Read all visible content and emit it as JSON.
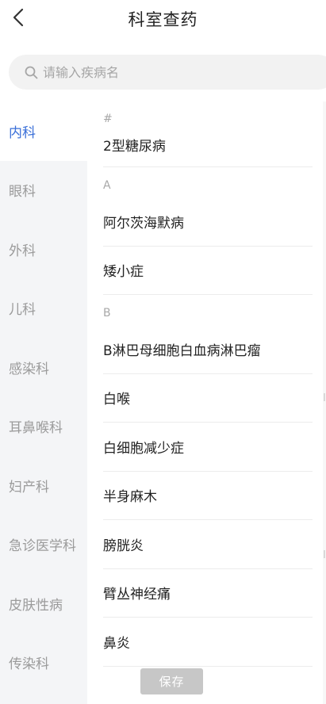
{
  "header": {
    "title": "科室查药"
  },
  "search": {
    "placeholder": "请输入疾病名",
    "value": ""
  },
  "sidebar": {
    "active_index": 0,
    "items": [
      {
        "label": "内科"
      },
      {
        "label": "眼科"
      },
      {
        "label": "外科"
      },
      {
        "label": "儿科"
      },
      {
        "label": "感染科"
      },
      {
        "label": "耳鼻喉科"
      },
      {
        "label": "妇产科"
      },
      {
        "label": "急诊医学科"
      },
      {
        "label": "皮肤性病"
      },
      {
        "label": "传染科"
      }
    ]
  },
  "list": {
    "sections": [
      {
        "letter": "#",
        "items": [
          "2型糖尿病"
        ]
      },
      {
        "letter": "A",
        "items": [
          "阿尔茨海默病",
          "矮小症"
        ]
      },
      {
        "letter": "B",
        "items": [
          "B淋巴母细胞白血病淋巴瘤",
          "白喉",
          "白细胞减少症",
          "半身麻木",
          "膀胱炎",
          "臂丛神经痛",
          "鼻炎"
        ]
      }
    ]
  },
  "footer": {
    "save_label": "保存"
  },
  "colors": {
    "accent": "#3a6fd8",
    "sidebar_bg": "#f4f5f7",
    "muted_text": "#9b9b9b",
    "search_bg": "#f2f2f2",
    "save_button_bg": "#c7c7c7"
  },
  "icons": {
    "back": "chevron-left-icon",
    "search": "search-icon"
  }
}
